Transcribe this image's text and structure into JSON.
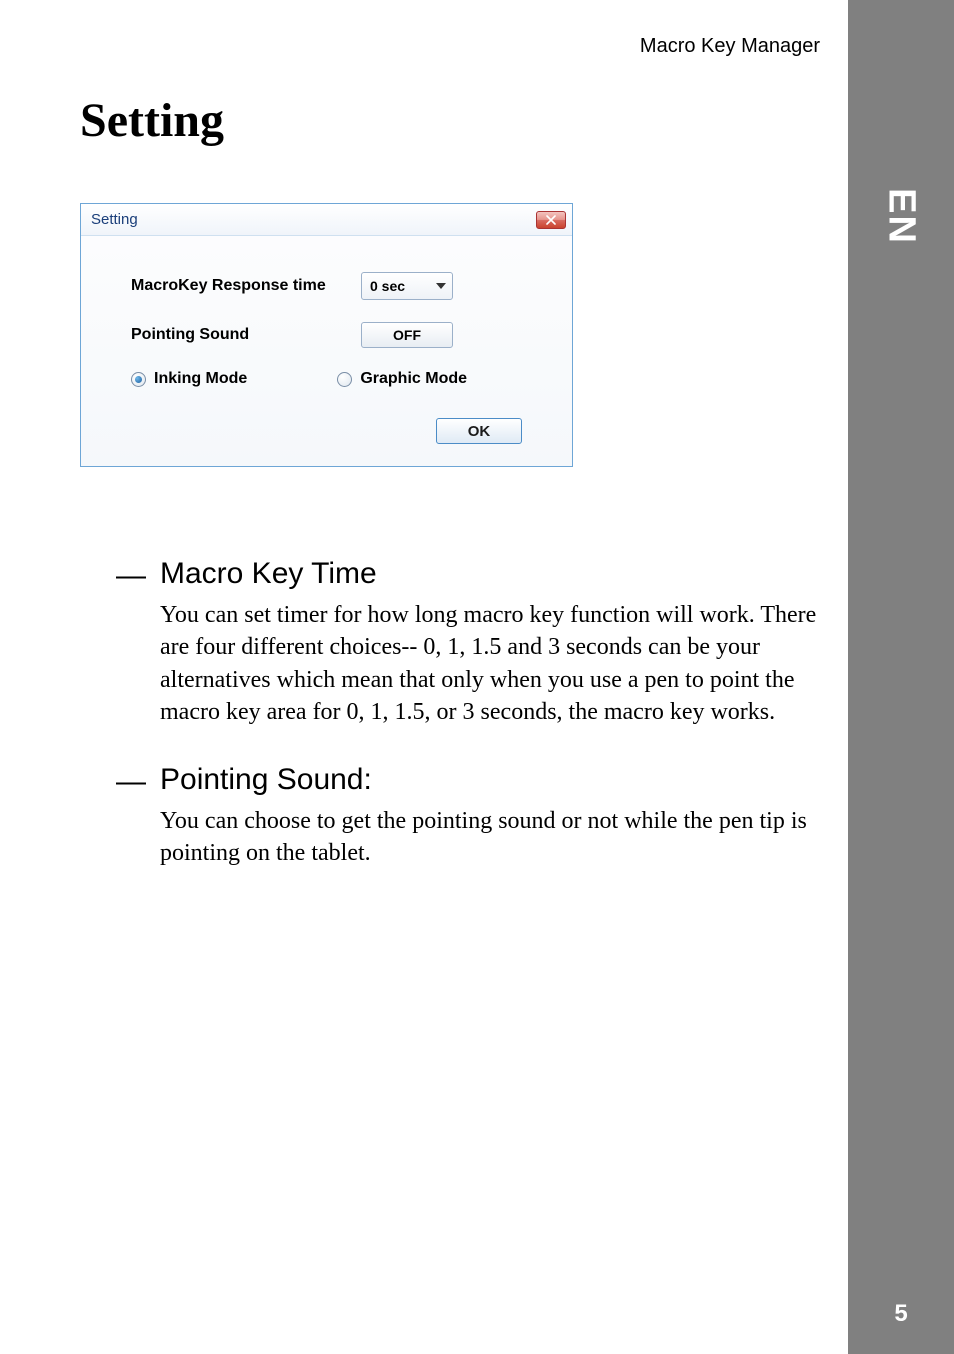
{
  "header": {
    "app_name": "Macro Key Manager"
  },
  "page": {
    "title": "Setting",
    "lang": "EN",
    "number": "5"
  },
  "dialog": {
    "title": "Setting",
    "rows": {
      "response_label": "MacroKey Response time",
      "response_value": "0 sec",
      "pointing_label": "Pointing Sound",
      "pointing_value": "OFF"
    },
    "radios": {
      "inking": "Inking Mode",
      "graphic": "Graphic Mode"
    },
    "ok_label": "OK"
  },
  "sections": [
    {
      "title": "Macro Key Time",
      "body": "You can set timer for how long macro key function will work. There are four different choices-- 0, 1, 1.5 and 3 seconds can be your alternatives which mean that only when you use a pen to point the macro key area for 0, 1, 1.5, or 3 seconds, the macro key works."
    },
    {
      "title": "Pointing Sound:",
      "body": "You can choose to get the pointing sound or not while the pen tip is pointing on the tablet."
    }
  ]
}
